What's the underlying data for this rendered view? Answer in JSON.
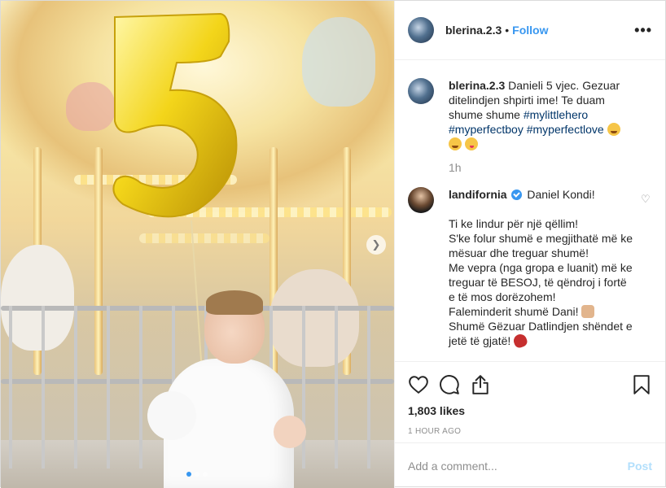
{
  "post": {
    "owner": {
      "username": "blerina.2.3",
      "follow_label": "Follow",
      "separator": "•"
    },
    "caption": {
      "username": "blerina.2.3",
      "text": "Danieli 5 vjec. Gezuar ditelindjen shpirti ime! Te duam shume shume",
      "hashtags": [
        "#mylittlehero",
        "#myperfectboy",
        "#myperfectlove"
      ],
      "time_ago": "1h"
    },
    "comments": [
      {
        "username": "landifornia",
        "verified": true,
        "first_line": "Daniel Kondi!",
        "lines": [
          "Ti ke lindur për një qëllim!",
          "S'ke folur shumë e megjithatë më ke mësuar dhe treguar shumë!",
          "Me vepra (nga gropa e luanit) më ke treguar të BESOJ, të qëndroj i fortë e të mos dorëzohem!",
          "Faleminderit shumë Dani!",
          "Shumë Gëzuar Datlindjen shëndet e jetë të gjatë!"
        ]
      }
    ],
    "likes": "1,803 likes",
    "posted": "1 HOUR AGO",
    "add_comment_placeholder": "Add a comment...",
    "post_button": "Post"
  },
  "media": {
    "balloon_number": "5",
    "carousel_dots": 3,
    "active_dot": 0
  },
  "icons": {
    "more": "more-options-icon",
    "like": "heart-icon",
    "comment": "comment-icon",
    "share": "share-icon",
    "save": "bookmark-icon",
    "next": "chevron-right-icon"
  },
  "colors": {
    "accent": "#3897f0",
    "hashtag": "#003569",
    "muted": "#8e8e8e",
    "post_disabled": "#b2dffc"
  }
}
